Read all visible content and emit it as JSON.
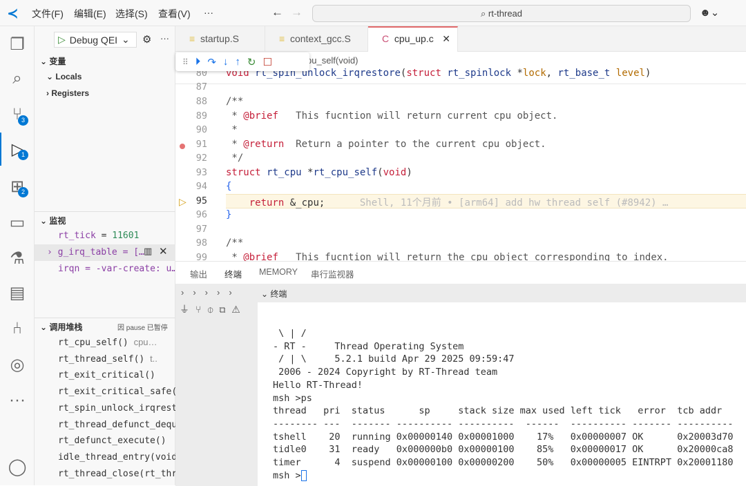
{
  "titlebar": {
    "menus": [
      "文件(F)",
      "编辑(E)",
      "选择(S)",
      "查看(V)",
      "···"
    ],
    "search": "rt-thread",
    "back": "←",
    "forward": "→"
  },
  "activity": {
    "badges": {
      "scm": "3",
      "debug": "1",
      "extensions": "2"
    }
  },
  "sidebar": {
    "config": "Debug QEI",
    "variables_title": "变量",
    "locals": "Locals",
    "registers": "Registers",
    "watch_title": "监视",
    "watch": [
      {
        "name": "rt_tick",
        "value": "11601"
      },
      {
        "name": "g_irq_table",
        "value": "[…"
      },
      {
        "name": "irqn",
        "value": "-var-create: u…"
      }
    ],
    "callstack_title": "调用堆栈",
    "callstack_status": "因 pause 已暂停",
    "frames": [
      {
        "fn": "rt_cpu_self()",
        "file": "cpu…"
      },
      {
        "fn": "rt_thread_self()",
        "file": "t.."
      },
      {
        "fn": "rt_exit_critical()",
        "file": ""
      },
      {
        "fn": "rt_exit_critical_safe(",
        "file": ""
      },
      {
        "fn": "rt_spin_unlock_irqrest",
        "file": ""
      },
      {
        "fn": "rt_thread_defunct_dequ",
        "file": ""
      },
      {
        "fn": "rt_defunct_execute()",
        "file": ""
      },
      {
        "fn": "idle_thread_entry(void",
        "file": ""
      },
      {
        "fn": "rt_thread_close(rt_thr",
        "file": ""
      }
    ]
  },
  "tabs": [
    {
      "label": "startup.S"
    },
    {
      "label": "context_gcc.S"
    },
    {
      "label": "cpu_up.c"
    }
  ],
  "editor": {
    "breadcrumb_tail": "pu_self(void)",
    "current_line": "95",
    "blame": "Shell, 11个月前 • [arm64] add hw thread self (#8942) …",
    "line_numbers": [
      "80",
      "87",
      "88",
      "89",
      "90",
      "91",
      "92",
      "93",
      "94",
      "95",
      "96",
      "97",
      "98",
      "99"
    ]
  },
  "panel": {
    "tabs": [
      "输出",
      "终端",
      "MEMORY",
      "串行监视器"
    ],
    "terminal_title": "终端",
    "terminal_lines": [
      " \\ | /",
      "- RT -     Thread Operating System",
      " / | \\     5.2.1 build Apr 29 2025 09:59:47",
      " 2006 - 2024 Copyright by RT-Thread team",
      "Hello RT-Thread!",
      "msh >ps",
      "thread   pri  status      sp     stack size max used left tick   error  tcb addr",
      "-------- ---  ------- ---------- ----------  ------  ---------- ------- ----------",
      "tshell    20  running 0x00000140 0x00001000    17%   0x00000007 OK      0x20003d70",
      "tidle0    31  ready   0x000000b0 0x00000100    85%   0x00000017 OK      0x20000ca8",
      "timer      4  suspend 0x00000100 0x00000200    50%   0x00000005 EINTRPT 0x20001180"
    ],
    "prompt": "msh >"
  },
  "colors": {
    "accent": "#0078d4",
    "tab_active": "#e0686a",
    "current_line": "#fdf6e3"
  }
}
